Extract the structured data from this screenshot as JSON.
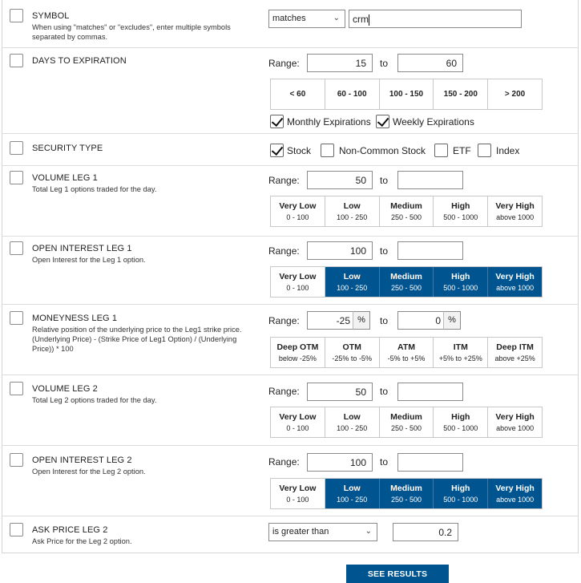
{
  "symbol": {
    "title": "SYMBOL",
    "desc": "When using \"matches\" or \"excludes\", enter multiple symbols separated by commas.",
    "match_mode": "matches",
    "value": "crm"
  },
  "dte": {
    "title": "DAYS TO EXPIRATION",
    "range_label": "Range:",
    "to_label": "to",
    "from_value": "15",
    "to_value": "60",
    "presets": [
      "< 60",
      "60 - 100",
      "100 - 150",
      "150 - 200",
      "> 200"
    ],
    "monthly_label": "Monthly Expirations",
    "weekly_label": "Weekly Expirations",
    "monthly_checked": true,
    "weekly_checked": true
  },
  "security_type": {
    "title": "SECURITY TYPE",
    "options": [
      {
        "label": "Stock",
        "checked": true
      },
      {
        "label": "Non-Common Stock",
        "checked": false
      },
      {
        "label": "ETF",
        "checked": false
      },
      {
        "label": "Index",
        "checked": false
      }
    ]
  },
  "volume_leg1": {
    "title": "VOLUME LEG 1",
    "desc": "Total Leg 1 options traded for the day.",
    "range_label": "Range:",
    "to_label": "to",
    "from_value": "50",
    "to_value": "",
    "presets": [
      {
        "label": "Very Low",
        "sub": "0 - 100",
        "active": false
      },
      {
        "label": "Low",
        "sub": "100 - 250",
        "active": false
      },
      {
        "label": "Medium",
        "sub": "250 - 500",
        "active": false
      },
      {
        "label": "High",
        "sub": "500 - 1000",
        "active": false
      },
      {
        "label": "Very High",
        "sub": "above 1000",
        "active": false
      }
    ]
  },
  "oi_leg1": {
    "title": "OPEN INTEREST LEG 1",
    "desc": "Open Interest for the Leg 1 option.",
    "range_label": "Range:",
    "to_label": "to",
    "from_value": "100",
    "to_value": "",
    "presets": [
      {
        "label": "Very Low",
        "sub": "0 - 100",
        "active": false
      },
      {
        "label": "Low",
        "sub": "100 - 250",
        "active": true
      },
      {
        "label": "Medium",
        "sub": "250 - 500",
        "active": true
      },
      {
        "label": "High",
        "sub": "500 - 1000",
        "active": true
      },
      {
        "label": "Very High",
        "sub": "above 1000",
        "active": true
      }
    ]
  },
  "moneyness_leg1": {
    "title": "MONEYNESS LEG 1",
    "desc": "Relative position of the underlying price to the Leg1 strike price. (Underlying Price) - (Strike Price of Leg1 Option) / (Underlying Price)) * 100",
    "range_label": "Range:",
    "to_label": "to",
    "from_value": "-25",
    "to_value": "0",
    "pct": "%",
    "presets": [
      {
        "label": "Deep OTM",
        "sub": "below -25%",
        "active": false
      },
      {
        "label": "OTM",
        "sub": "-25% to -5%",
        "active": false
      },
      {
        "label": "ATM",
        "sub": "-5% to +5%",
        "active": false
      },
      {
        "label": "ITM",
        "sub": "+5% to +25%",
        "active": false
      },
      {
        "label": "Deep ITM",
        "sub": "above +25%",
        "active": false
      }
    ]
  },
  "volume_leg2": {
    "title": "VOLUME LEG 2",
    "desc": "Total Leg 2 options traded for the day.",
    "range_label": "Range:",
    "to_label": "to",
    "from_value": "50",
    "to_value": "",
    "presets": [
      {
        "label": "Very Low",
        "sub": "0 - 100",
        "active": false
      },
      {
        "label": "Low",
        "sub": "100 - 250",
        "active": false
      },
      {
        "label": "Medium",
        "sub": "250 - 500",
        "active": false
      },
      {
        "label": "High",
        "sub": "500 - 1000",
        "active": false
      },
      {
        "label": "Very High",
        "sub": "above 1000",
        "active": false
      }
    ]
  },
  "oi_leg2": {
    "title": "OPEN INTEREST LEG 2",
    "desc": "Open Interest for the Leg 2 option.",
    "range_label": "Range:",
    "to_label": "to",
    "from_value": "100",
    "to_value": "",
    "presets": [
      {
        "label": "Very Low",
        "sub": "0 - 100",
        "active": false
      },
      {
        "label": "Low",
        "sub": "100 - 250",
        "active": true
      },
      {
        "label": "Medium",
        "sub": "250 - 500",
        "active": true
      },
      {
        "label": "High",
        "sub": "500 - 1000",
        "active": true
      },
      {
        "label": "Very High",
        "sub": "above 1000",
        "active": true
      }
    ]
  },
  "ask_leg2": {
    "title": "ASK PRICE LEG 2",
    "desc": "Ask Price for the Leg 2 option.",
    "operator": "is greater than",
    "value": "0.2"
  },
  "see_results_label": "SEE RESULTS",
  "colors": {
    "accent": "#005590",
    "border": "#8a8a8a"
  }
}
